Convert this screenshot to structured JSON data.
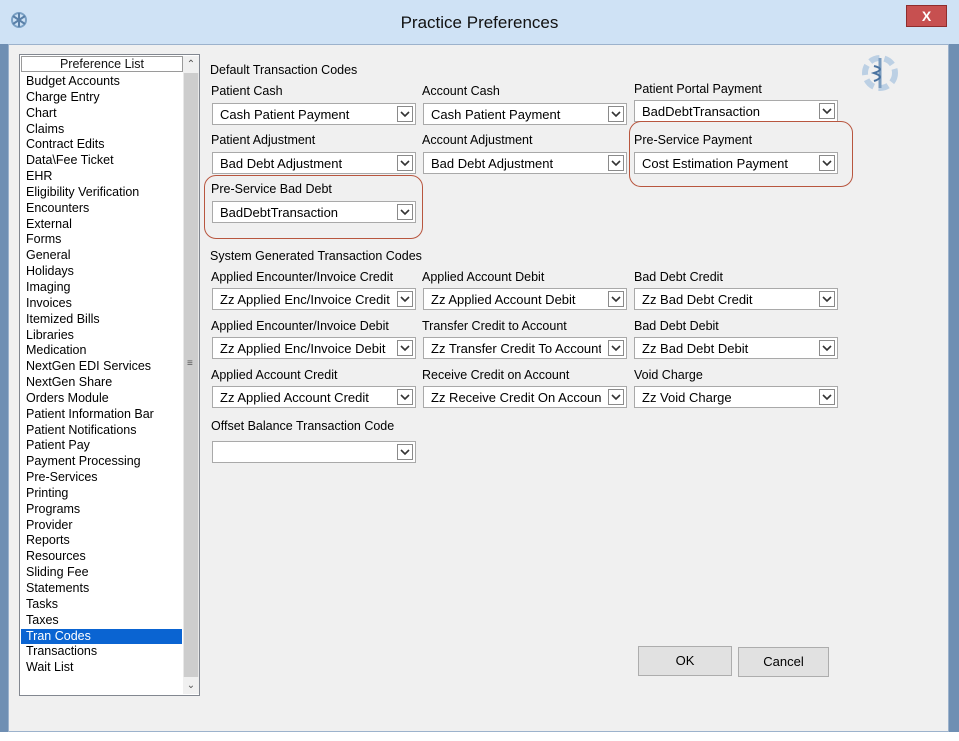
{
  "window": {
    "title": "Practice Preferences",
    "close_label": "X"
  },
  "preference_list": {
    "header": "Preference List",
    "items": [
      "Budget Accounts",
      "Charge Entry",
      "Chart",
      "Claims",
      "Contract Edits",
      "Data\\Fee Ticket",
      "EHR",
      "Eligibility Verification",
      "Encounters",
      "External",
      "Forms",
      "General",
      "Holidays",
      "Imaging",
      "Invoices",
      "Itemized Bills",
      "Libraries",
      "Medication",
      "NextGen EDI Services",
      "NextGen Share",
      "Orders Module",
      "Patient Information Bar",
      "Patient Notifications",
      "Patient Pay",
      "Payment Processing",
      "Pre-Services",
      "Printing",
      "Programs",
      "Provider",
      "Reports",
      "Resources",
      "Sliding Fee",
      "Statements",
      "Tasks",
      "Taxes",
      "Tran Codes",
      "Transactions",
      "Wait List"
    ],
    "selected": "Tran Codes"
  },
  "default_codes": {
    "heading": "Default Transaction Codes",
    "patient_cash": {
      "label": "Patient Cash",
      "value": "Cash Patient Payment"
    },
    "account_cash": {
      "label": "Account Cash",
      "value": "Cash Patient Payment"
    },
    "portal_payment": {
      "label": "Patient Portal Payment",
      "value": "BadDebtTransaction"
    },
    "patient_adjustment": {
      "label": "Patient Adjustment",
      "value": "Bad Debt Adjustment"
    },
    "account_adjustment": {
      "label": "Account Adjustment",
      "value": "Bad Debt Adjustment"
    },
    "pre_service_payment": {
      "label": "Pre-Service Payment",
      "value": "Cost Estimation Payment"
    },
    "pre_service_bad_debt": {
      "label": "Pre-Service Bad Debt",
      "value": "BadDebtTransaction"
    }
  },
  "system_codes": {
    "heading": "System Generated Transaction Codes",
    "applied_enc_credit": {
      "label": "Applied Encounter/Invoice Credit",
      "value": "Zz Applied Enc/Invoice Credit"
    },
    "applied_account_debit": {
      "label": "Applied Account Debit",
      "value": "Zz Applied Account Debit"
    },
    "bad_debt_credit": {
      "label": "Bad Debt Credit",
      "value": "Zz Bad Debt Credit"
    },
    "applied_enc_debit": {
      "label": "Applied Encounter/Invoice Debit",
      "value": "Zz Applied Enc/Invoice Debit"
    },
    "transfer_credit": {
      "label": "Transfer Credit to Account",
      "value": "Zz Transfer Credit To Account"
    },
    "bad_debt_debit": {
      "label": "Bad Debt Debit",
      "value": "Zz Bad Debt Debit"
    },
    "applied_account_credit": {
      "label": "Applied Account Credit",
      "value": "Zz Applied Account Credit"
    },
    "receive_credit": {
      "label": "Receive Credit on Account",
      "value": "Zz Receive Credit On Account"
    },
    "void_charge": {
      "label": "Void Charge",
      "value": "Zz Void Charge"
    }
  },
  "offset": {
    "label": "Offset Balance Transaction Code",
    "value": ""
  },
  "buttons": {
    "ok": "OK",
    "cancel": "Cancel"
  },
  "colors": {
    "titlebar": "#cfe2f5",
    "selection": "#0a64d2",
    "highlight_ring": "#b8563f",
    "close": "#c75050"
  }
}
